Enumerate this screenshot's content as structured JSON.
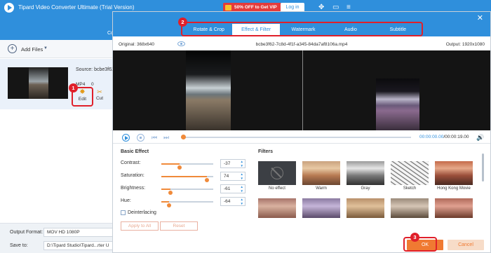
{
  "app": {
    "title": "Tipard Video Converter Ultimate (Trial Version)",
    "promo": "50% OFF to Get VIP",
    "login": "Log in",
    "nav_tab": "Co"
  },
  "main": {
    "add_files": "Add Files",
    "source_label": "Source: bcbe3f62",
    "format_label": "MP4",
    "format_extra": "0",
    "edit_label": "Edit",
    "cut_label": "Cut",
    "output_format_label": "Output Format:",
    "output_format_value": "MOV HD 1080P",
    "save_to_label": "Save to:",
    "save_to_value": "D:\\Tipard Studio\\Tipard...rter U"
  },
  "dialog": {
    "tabs": [
      "Rotate & Crop",
      "Effect & Filter",
      "Watermark",
      "Audio",
      "Subtitle"
    ],
    "active_tab": "Effect & Filter",
    "original": "Original: 368x640",
    "filename": "bcbe3f62-7c8d-4f1f-a345-84da7af8106a.mp4",
    "output": "Output: 1920x1080",
    "time_current": "00:00:00.00",
    "time_total": "/00:00:19.00",
    "basic_effect_title": "Basic Effect",
    "adjustments": [
      {
        "label": "Contrast:",
        "value": "-37",
        "level": 0.35
      },
      {
        "label": "Saturation:",
        "value": "74",
        "level": 0.88
      },
      {
        "label": "Brightness:",
        "value": "-61",
        "level": 0.17
      },
      {
        "label": "Hue:",
        "value": "-64",
        "level": 0.15
      }
    ],
    "deinterlacing": "Deinterlacing",
    "apply_to_all": "Apply to All",
    "reset": "Reset",
    "filters_title": "Filters",
    "filters": [
      "No effect",
      "Warm",
      "Gray",
      "Sketch",
      "Hong Kong Movie"
    ],
    "ok": "OK",
    "cancel": "Cancel"
  },
  "annotations": [
    "1",
    "2",
    "3"
  ],
  "colors": {
    "accent": "#2f8fdc",
    "orange": "#f07a32",
    "annotation_red": "#e0202a"
  }
}
